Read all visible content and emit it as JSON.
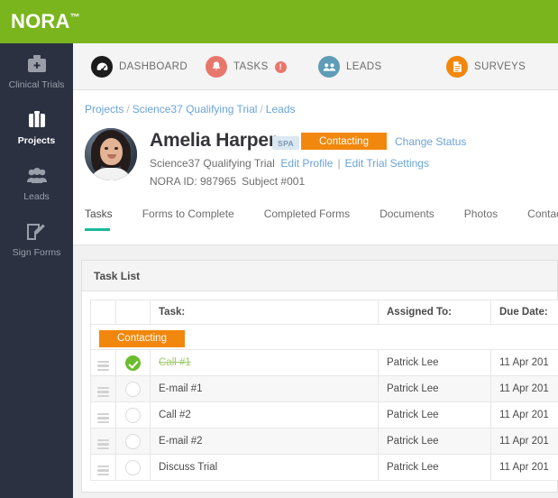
{
  "brand": {
    "name": "NORA",
    "tm": "™",
    "color": "#7ab51d"
  },
  "sidebar": {
    "items": [
      {
        "label": "Clinical Trials",
        "icon": "medical-bag-icon",
        "active": false
      },
      {
        "label": "Projects",
        "icon": "briefcase-icon",
        "active": true
      },
      {
        "label": "Leads",
        "icon": "people-icon",
        "active": false
      },
      {
        "label": "Sign Forms",
        "icon": "edit-form-icon",
        "active": false
      }
    ]
  },
  "topnav": {
    "items": [
      {
        "label": "DASHBOARD",
        "icon": "dashboard-gauge-icon",
        "color": "#1b1b1b",
        "badge": ""
      },
      {
        "label": "TASKS",
        "icon": "bell-icon",
        "color": "#e8776b",
        "badge": "!"
      },
      {
        "label": "LEADS",
        "icon": "people-icon",
        "color": "#5e9cb8",
        "badge": ""
      },
      {
        "label": "SURVEYS",
        "icon": "document-icon",
        "color": "#f2870d",
        "badge": ""
      }
    ]
  },
  "breadcrumb": {
    "items": [
      "Projects",
      "Science37 Qualifying Trial",
      "Leads"
    ],
    "separator": "/"
  },
  "patient": {
    "name": "Amelia Harper",
    "spa_badge": "SPA",
    "status": "Contacting",
    "status_color": "#f2870d",
    "change_status": "Change Status",
    "trial": "Science37 Qualifying Trial",
    "edit_profile": "Edit Profile",
    "pipe": "|",
    "edit_trial_settings": "Edit Trial Settings",
    "nora_id": "NORA ID: 987965",
    "subject": "Subject #001",
    "avatar": "avatar"
  },
  "tabs": [
    {
      "label": "Tasks",
      "active": true
    },
    {
      "label": "Forms to Complete",
      "active": false
    },
    {
      "label": "Completed Forms",
      "active": false
    },
    {
      "label": "Documents",
      "active": false
    },
    {
      "label": "Photos",
      "active": false
    },
    {
      "label": "Contacts",
      "active": false
    }
  ],
  "task_panel": {
    "title": "Task List",
    "columns": [
      "",
      "",
      "Task:",
      "Assigned To:",
      "Due Date:"
    ],
    "group_label": "Contacting",
    "rows": [
      {
        "task": "Call #1",
        "assigned": "Patrick Lee",
        "due": "11 Apr 201",
        "done": true
      },
      {
        "task": "E-mail #1",
        "assigned": "Patrick Lee",
        "due": "11 Apr 201",
        "done": false
      },
      {
        "task": "Call #2",
        "assigned": "Patrick Lee",
        "due": "11 Apr 201",
        "done": false
      },
      {
        "task": "E-mail #2",
        "assigned": "Patrick Lee",
        "due": "11 Apr 201",
        "done": false
      },
      {
        "task": "Discuss Trial",
        "assigned": "Patrick Lee",
        "due": "11 Apr 201",
        "done": false
      }
    ]
  }
}
